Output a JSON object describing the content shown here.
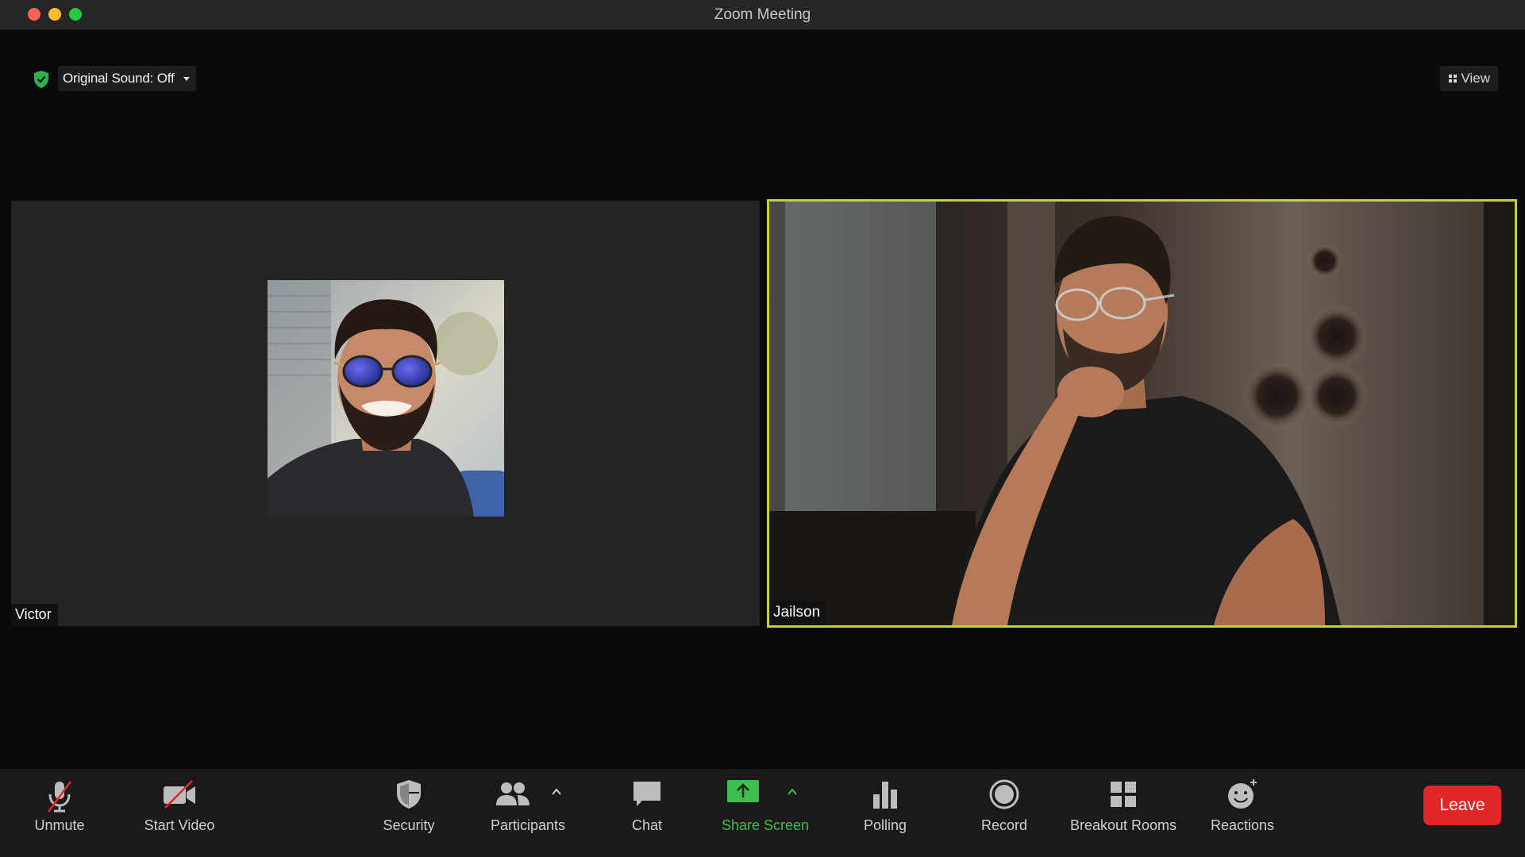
{
  "window": {
    "title": "Zoom Meeting"
  },
  "top_controls": {
    "original_sound_label": "Original Sound: Off",
    "view_label": "View"
  },
  "participants": [
    {
      "name": "Victor",
      "video": "off",
      "avatar": "profile-photo"
    },
    {
      "name": "Jailson",
      "video": "on",
      "active_speaker": true
    }
  ],
  "toolbar": {
    "unmute": "Unmute",
    "start_video": "Start Video",
    "security": "Security",
    "participants": "Participants",
    "chat": "Chat",
    "share_screen": "Share Screen",
    "polling": "Polling",
    "record": "Record",
    "breakout_rooms": "Breakout Rooms",
    "reactions": "Reactions",
    "leave": "Leave"
  },
  "colors": {
    "active_speaker_border": "#c7d12b",
    "share_screen": "#3fbf4f",
    "leave": "#e02828",
    "muted_slash": "#e02828"
  }
}
